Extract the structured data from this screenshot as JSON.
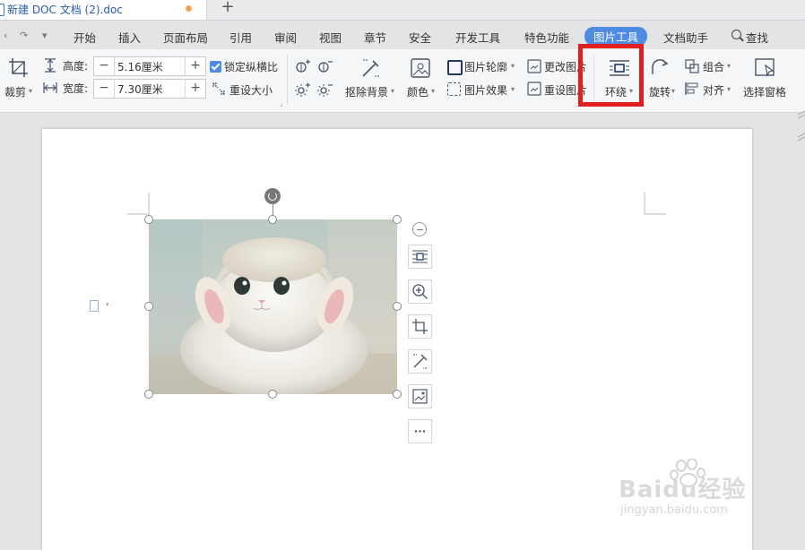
{
  "tabbar": {
    "doc_title": "新建 DOC 文档 (2).doc",
    "new_tab": "+"
  },
  "menu": {
    "items": [
      "开始",
      "插入",
      "页面布局",
      "引用",
      "审阅",
      "视图",
      "章节",
      "安全",
      "开发工具",
      "特色功能",
      "图片工具",
      "文档助手"
    ],
    "active": "图片工具",
    "search_label": "查找"
  },
  "ribbon": {
    "crop_label": "裁剪",
    "height_label": "高度:",
    "height_value": "5.16厘米",
    "width_label": "宽度:",
    "width_value": "7.30厘米",
    "lock_ratio_label": "锁定纵横比",
    "lock_ratio_checked": true,
    "reset_size_label": "重设大小",
    "remove_bg_label": "抠除背景",
    "color_label": "颜色",
    "outline_label": "图片轮廓",
    "effect_label": "图片效果",
    "change_image_label": "更改图片",
    "reset_image_label": "重设图片",
    "wrap_label": "环绕",
    "rotate_label": "旋转",
    "group_label": "组合",
    "align_label": "对齐",
    "selection_pane_label": "选择窗格"
  },
  "colors": {
    "accent": "#4f8ae3",
    "highlight": "#e02020"
  },
  "watermark": {
    "brand": "Baidu经验",
    "url": "jingyan.baidu.com"
  }
}
